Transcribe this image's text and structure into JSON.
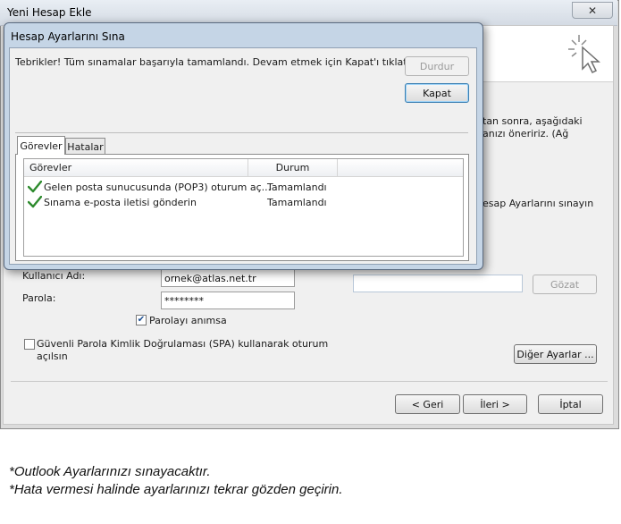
{
  "outer_window": {
    "title": "Yeni Hesap Ekle",
    "close_icon": "close-icon",
    "background_text": {
      "line1": "tan sonra, aşağıdaki",
      "line2": "anızı öneririz. (Ağ",
      "line3": "esap Ayarlarını sınayın"
    },
    "username_label": "Kullanıcı Adı:",
    "username_value": "ornek@atlas.net.tr",
    "password_label": "Parola:",
    "password_value": "********",
    "remember_password_label": "Parolayı anımsa",
    "remember_password_checked": true,
    "spa_label_line1": "Güvenli Parola Kimlik Doğrulaması (SPA) kullanarak oturum",
    "spa_label_line2": "açılsın",
    "spa_checked": false,
    "browse_button": "Gözat",
    "more_settings_button": "Diğer Ayarlar ...",
    "back_button": "< Geri",
    "next_button": "İleri >",
    "cancel_button": "İptal"
  },
  "dialog": {
    "title": "Hesap Ayarlarını Sına",
    "message": "Tebrikler! Tüm sınamalar başarıyla tamamlandı. Devam etmek için Kapat'ı tıklatın.",
    "stop_button": "Durdur",
    "close_button": "Kapat",
    "tabs": [
      {
        "label": "Görevler",
        "active": true
      },
      {
        "label": "Hatalar",
        "active": false
      }
    ],
    "columns": [
      "Görevler",
      "Durum"
    ],
    "tasks": [
      {
        "task": "Gelen posta sunucusunda (POP3) oturum aç...",
        "status": "Tamamlandı",
        "icon": "checkmark-icon"
      },
      {
        "task": "Sınama e-posta iletisi gönderin",
        "status": "Tamamlandı",
        "icon": "checkmark-icon"
      }
    ]
  },
  "captions": [
    "*Outlook Ayarlarınızı sınayacaktır.",
    "*Hata vermesi halinde ayarlarınızı tekrar gözden geçirin."
  ],
  "colors": {
    "dialog_frame": "#c5d5e6",
    "check_green": "#2e8b2e",
    "default_button_border": "#3c7fb1"
  }
}
